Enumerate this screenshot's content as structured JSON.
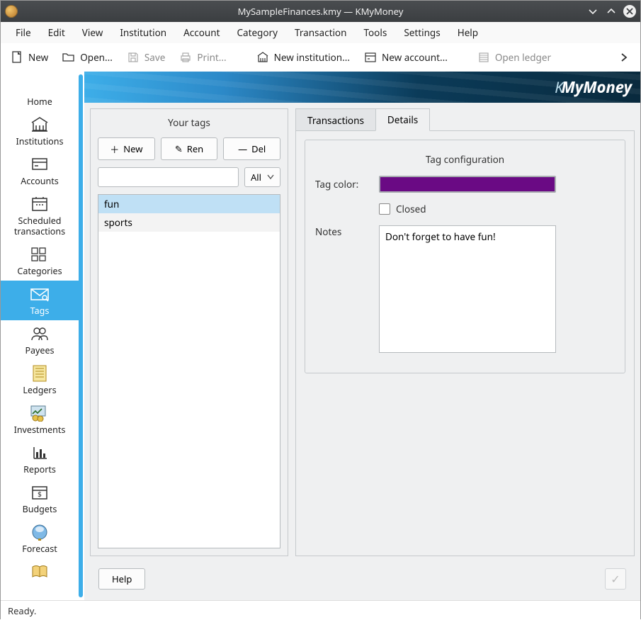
{
  "window": {
    "title": "MySampleFinances.kmy — KMyMoney"
  },
  "menubar": [
    "File",
    "Edit",
    "View",
    "Institution",
    "Account",
    "Category",
    "Transaction",
    "Tools",
    "Settings",
    "Help"
  ],
  "toolbar": {
    "new": "New",
    "open": "Open...",
    "save": "Save",
    "print": "Print...",
    "new_institution": "New institution...",
    "new_account": "New account...",
    "open_ledger": "Open ledger"
  },
  "sidebar": {
    "items": [
      {
        "label": "Home"
      },
      {
        "label": "Institutions"
      },
      {
        "label": "Accounts"
      },
      {
        "label": "Scheduled transactions"
      },
      {
        "label": "Categories"
      },
      {
        "label": "Tags"
      },
      {
        "label": "Payees"
      },
      {
        "label": "Ledgers"
      },
      {
        "label": "Investments"
      },
      {
        "label": "Reports"
      },
      {
        "label": "Budgets"
      },
      {
        "label": "Forecast"
      }
    ]
  },
  "banner": {
    "brand_k": "K",
    "brand_rest": "MyMoney"
  },
  "tags_panel": {
    "title": "Your tags",
    "new_btn": "New",
    "ren_btn": "Ren",
    "del_btn": "Del",
    "filter_value": "",
    "filter_select": "All",
    "tags": [
      "fun",
      "sports"
    ],
    "selected_index": 0
  },
  "details": {
    "tabs": [
      "Transactions",
      "Details"
    ],
    "active_tab": 1,
    "legend": "Tag configuration",
    "tag_color_label": "Tag color:",
    "tag_color": "#6a0a84",
    "closed_label": "Closed",
    "closed": false,
    "notes_label": "Notes",
    "notes_value": "Don't forget to have fun!"
  },
  "bottom": {
    "help": "Help"
  },
  "status": {
    "text": "Ready."
  }
}
